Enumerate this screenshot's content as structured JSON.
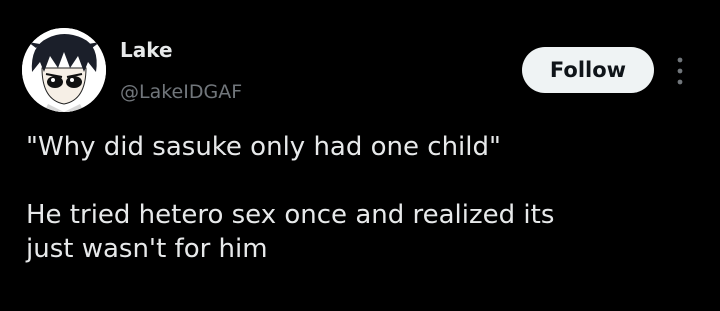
{
  "author": {
    "display_name": "Lake",
    "handle": "@LakeIDGAF",
    "avatar_icon": "anime-character-avatar"
  },
  "actions": {
    "follow_label": "Follow",
    "more_icon": "vertical-ellipsis-icon"
  },
  "tweet": {
    "line1": "\"Why did sasuke only had one child\"",
    "line2": "He tried hetero sex once and realized its",
    "line3": "just wasn't for him"
  },
  "colors": {
    "background": "#000000",
    "text_primary": "#e7e9ea",
    "text_secondary": "#71767b",
    "follow_bg": "#eff3f4",
    "follow_text": "#0f1419"
  }
}
